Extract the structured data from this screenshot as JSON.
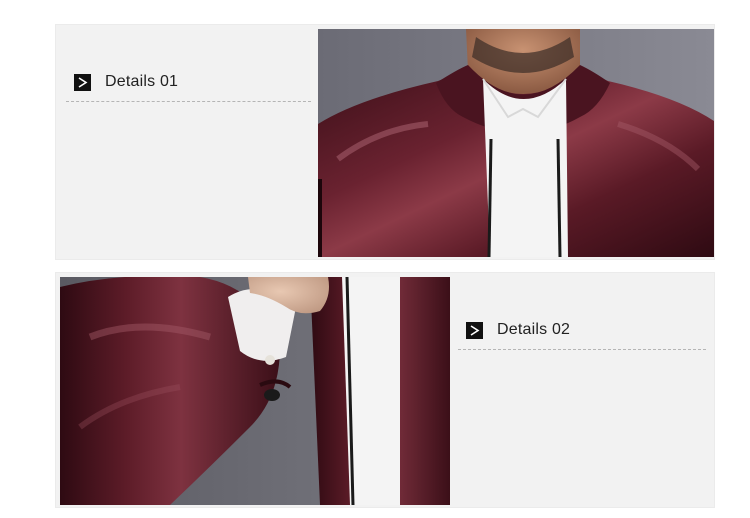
{
  "sections": [
    {
      "label": "Details 01",
      "icon": "chevron-right-icon"
    },
    {
      "label": "Details 02",
      "icon": "chevron-right-icon"
    }
  ],
  "colors": {
    "card_background": "#f2f2f2",
    "leather": "#4a1420",
    "shirt": "#f4f4f4",
    "icon_box": "#111111"
  }
}
